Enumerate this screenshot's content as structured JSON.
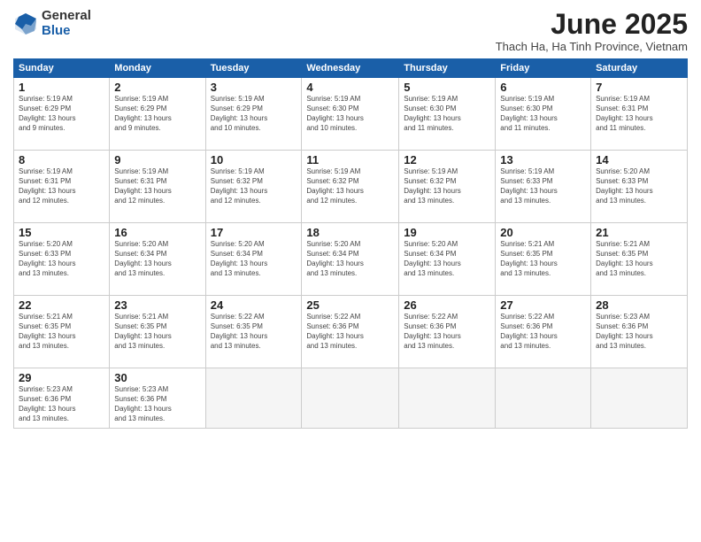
{
  "logo": {
    "general": "General",
    "blue": "Blue"
  },
  "title": "June 2025",
  "subtitle": "Thach Ha, Ha Tinh Province, Vietnam",
  "days_header": [
    "Sunday",
    "Monday",
    "Tuesday",
    "Wednesday",
    "Thursday",
    "Friday",
    "Saturday"
  ],
  "weeks": [
    [
      {
        "day": "1",
        "info": "Sunrise: 5:19 AM\nSunset: 6:29 PM\nDaylight: 13 hours\nand 9 minutes."
      },
      {
        "day": "2",
        "info": "Sunrise: 5:19 AM\nSunset: 6:29 PM\nDaylight: 13 hours\nand 9 minutes."
      },
      {
        "day": "3",
        "info": "Sunrise: 5:19 AM\nSunset: 6:29 PM\nDaylight: 13 hours\nand 10 minutes."
      },
      {
        "day": "4",
        "info": "Sunrise: 5:19 AM\nSunset: 6:30 PM\nDaylight: 13 hours\nand 10 minutes."
      },
      {
        "day": "5",
        "info": "Sunrise: 5:19 AM\nSunset: 6:30 PM\nDaylight: 13 hours\nand 11 minutes."
      },
      {
        "day": "6",
        "info": "Sunrise: 5:19 AM\nSunset: 6:30 PM\nDaylight: 13 hours\nand 11 minutes."
      },
      {
        "day": "7",
        "info": "Sunrise: 5:19 AM\nSunset: 6:31 PM\nDaylight: 13 hours\nand 11 minutes."
      }
    ],
    [
      {
        "day": "8",
        "info": "Sunrise: 5:19 AM\nSunset: 6:31 PM\nDaylight: 13 hours\nand 12 minutes."
      },
      {
        "day": "9",
        "info": "Sunrise: 5:19 AM\nSunset: 6:31 PM\nDaylight: 13 hours\nand 12 minutes."
      },
      {
        "day": "10",
        "info": "Sunrise: 5:19 AM\nSunset: 6:32 PM\nDaylight: 13 hours\nand 12 minutes."
      },
      {
        "day": "11",
        "info": "Sunrise: 5:19 AM\nSunset: 6:32 PM\nDaylight: 13 hours\nand 12 minutes."
      },
      {
        "day": "12",
        "info": "Sunrise: 5:19 AM\nSunset: 6:32 PM\nDaylight: 13 hours\nand 13 minutes."
      },
      {
        "day": "13",
        "info": "Sunrise: 5:19 AM\nSunset: 6:33 PM\nDaylight: 13 hours\nand 13 minutes."
      },
      {
        "day": "14",
        "info": "Sunrise: 5:20 AM\nSunset: 6:33 PM\nDaylight: 13 hours\nand 13 minutes."
      }
    ],
    [
      {
        "day": "15",
        "info": "Sunrise: 5:20 AM\nSunset: 6:33 PM\nDaylight: 13 hours\nand 13 minutes."
      },
      {
        "day": "16",
        "info": "Sunrise: 5:20 AM\nSunset: 6:34 PM\nDaylight: 13 hours\nand 13 minutes."
      },
      {
        "day": "17",
        "info": "Sunrise: 5:20 AM\nSunset: 6:34 PM\nDaylight: 13 hours\nand 13 minutes."
      },
      {
        "day": "18",
        "info": "Sunrise: 5:20 AM\nSunset: 6:34 PM\nDaylight: 13 hours\nand 13 minutes."
      },
      {
        "day": "19",
        "info": "Sunrise: 5:20 AM\nSunset: 6:34 PM\nDaylight: 13 hours\nand 13 minutes."
      },
      {
        "day": "20",
        "info": "Sunrise: 5:21 AM\nSunset: 6:35 PM\nDaylight: 13 hours\nand 13 minutes."
      },
      {
        "day": "21",
        "info": "Sunrise: 5:21 AM\nSunset: 6:35 PM\nDaylight: 13 hours\nand 13 minutes."
      }
    ],
    [
      {
        "day": "22",
        "info": "Sunrise: 5:21 AM\nSunset: 6:35 PM\nDaylight: 13 hours\nand 13 minutes."
      },
      {
        "day": "23",
        "info": "Sunrise: 5:21 AM\nSunset: 6:35 PM\nDaylight: 13 hours\nand 13 minutes."
      },
      {
        "day": "24",
        "info": "Sunrise: 5:22 AM\nSunset: 6:35 PM\nDaylight: 13 hours\nand 13 minutes."
      },
      {
        "day": "25",
        "info": "Sunrise: 5:22 AM\nSunset: 6:36 PM\nDaylight: 13 hours\nand 13 minutes."
      },
      {
        "day": "26",
        "info": "Sunrise: 5:22 AM\nSunset: 6:36 PM\nDaylight: 13 hours\nand 13 minutes."
      },
      {
        "day": "27",
        "info": "Sunrise: 5:22 AM\nSunset: 6:36 PM\nDaylight: 13 hours\nand 13 minutes."
      },
      {
        "day": "28",
        "info": "Sunrise: 5:23 AM\nSunset: 6:36 PM\nDaylight: 13 hours\nand 13 minutes."
      }
    ],
    [
      {
        "day": "29",
        "info": "Sunrise: 5:23 AM\nSunset: 6:36 PM\nDaylight: 13 hours\nand 13 minutes."
      },
      {
        "day": "30",
        "info": "Sunrise: 5:23 AM\nSunset: 6:36 PM\nDaylight: 13 hours\nand 13 minutes."
      },
      {
        "day": "",
        "info": ""
      },
      {
        "day": "",
        "info": ""
      },
      {
        "day": "",
        "info": ""
      },
      {
        "day": "",
        "info": ""
      },
      {
        "day": "",
        "info": ""
      }
    ]
  ]
}
